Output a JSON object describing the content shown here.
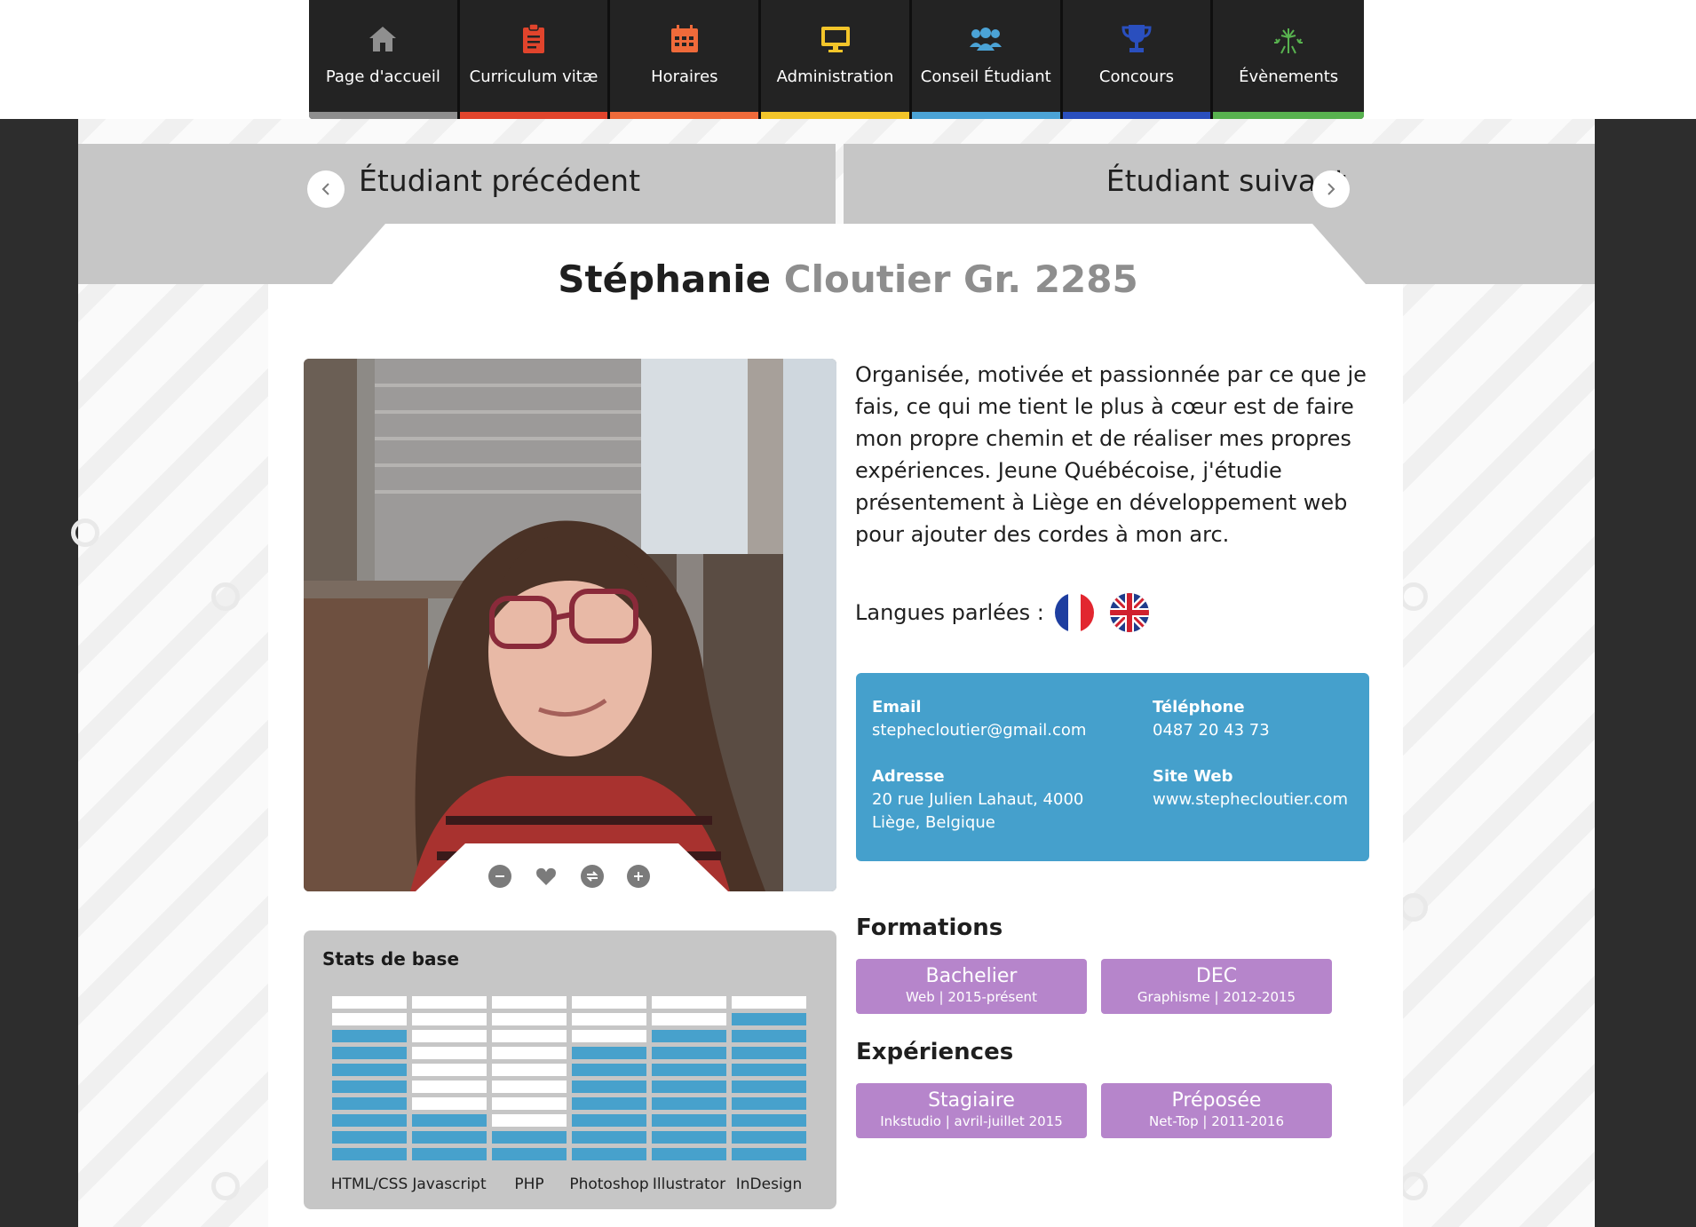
{
  "nav": {
    "items": [
      {
        "label": "Page d'accueil",
        "icon": "home-icon",
        "color": "#9a9a9a",
        "bar_color": "#8e8e8e"
      },
      {
        "label": "Curriculum vitæ",
        "icon": "clipboard-icon",
        "color": "#e1442c",
        "bar_color": "#e1442c"
      },
      {
        "label": "Horaires",
        "icon": "calendar-icon",
        "color": "#ef6a3a",
        "bar_color": "#ef6a3a"
      },
      {
        "label": "Administration",
        "icon": "monitor-icon",
        "color": "#f3c52a",
        "bar_color": "#f3c52a"
      },
      {
        "label": "Conseil Étudiant",
        "icon": "users-icon",
        "color": "#4ba3d6",
        "bar_color": "#4ba3d6"
      },
      {
        "label": "Concours",
        "icon": "trophy-icon",
        "color": "#2a4fbe",
        "bar_color": "#2a4fbe"
      },
      {
        "label": "Évènements",
        "icon": "fireworks-icon",
        "color": "#58b24f",
        "bar_color": "#58b24f"
      }
    ]
  },
  "student_nav": {
    "previous_label": "Étudiant précédent",
    "next_label": "Étudiant suivant"
  },
  "profile": {
    "first_name": "Stéphanie",
    "last_name_group": "Cloutier Gr. 2285",
    "bio": "Organisée, motivée et passionnée par ce que je fais, ce qui me tient le plus à cœur est de faire mon propre chemin et de réaliser mes propres expériences. Jeune Québécoise, j'étudie présentement à Liège en développement web pour ajouter des cordes à mon arc.",
    "languages_label": "Langues parlées :",
    "languages": [
      "french-flag-icon",
      "uk-flag-icon"
    ]
  },
  "contact": {
    "email_label": "Email",
    "email": "stephecloutier@gmail.com",
    "phone_label": "Téléphone",
    "phone": "0487 20 43 73",
    "address_label": "Adresse",
    "address_line1": "20 rue Julien Lahaut, 4000",
    "address_line2": "Liège, Belgique",
    "website_label": "Site Web",
    "website": "www.stephecloutier.com"
  },
  "formations": {
    "title": "Formations",
    "items": [
      {
        "title": "Bachelier",
        "sub": "Web | 2015-présent"
      },
      {
        "title": "DEC",
        "sub": "Graphisme | 2012-2015"
      }
    ]
  },
  "experiences": {
    "title": "Expériences",
    "items": [
      {
        "title": "Stagiaire",
        "sub": "Inkstudio | avril-juillet 2015"
      },
      {
        "title": "Préposée",
        "sub": "Net-Top | 2011-2016"
      }
    ]
  },
  "photo_actions": [
    "minus-icon",
    "heart-icon",
    "swap-icon",
    "plus-icon"
  ],
  "stats": {
    "title": "Stats de base",
    "max_level": 10,
    "filled_color": "#47a1cc",
    "empty_color": "#ffffff",
    "items": [
      {
        "label": "HTML/CSS",
        "level": 8
      },
      {
        "label": "Javascript",
        "level": 3
      },
      {
        "label": "PHP",
        "level": 2
      },
      {
        "label": "Photoshop",
        "level": 7
      },
      {
        "label": "Illustrator",
        "level": 8
      },
      {
        "label": "InDesign",
        "level": 9
      }
    ]
  }
}
